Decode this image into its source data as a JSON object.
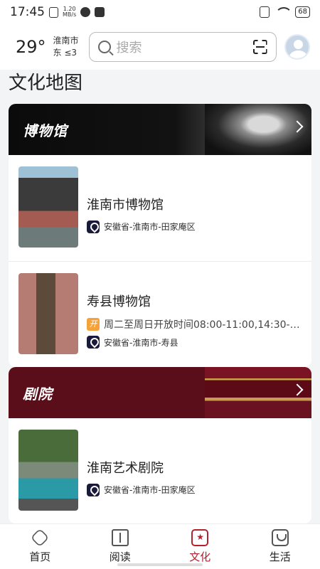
{
  "status_bar": {
    "time": "17:45",
    "net_speed": "1.20\nMB/s",
    "battery": "68"
  },
  "header": {
    "temperature": "29°",
    "location_line1": "淮南市",
    "location_line2": "东 ≤3",
    "search_placeholder": "搜索"
  },
  "page_title": "文化地图",
  "museums": {
    "label": "博物馆",
    "items": [
      {
        "name": "淮南市博物馆",
        "hours": "",
        "address": "安徽省-淮南市-田家庵区"
      },
      {
        "name": "寿县博物馆",
        "hours": "周二至周日开放时间08:00-11:00,14:30-…",
        "address": "安徽省-淮南市-寿县"
      }
    ]
  },
  "theaters": {
    "label": "剧院",
    "items": [
      {
        "name": "淮南艺术剧院",
        "address": "安徽省-淮南市-田家庵区"
      }
    ]
  },
  "open_icon_text": "开",
  "bottom_nav": [
    {
      "label": "首页",
      "icon": "home-icon"
    },
    {
      "label": "阅读",
      "icon": "book-icon"
    },
    {
      "label": "文化",
      "icon": "culture-icon",
      "active": true
    },
    {
      "label": "生活",
      "icon": "life-icon"
    }
  ],
  "colors": {
    "accent": "#b3222f",
    "theater_banner": "#5a0e1a",
    "museum_banner": "#0b0b0b"
  }
}
